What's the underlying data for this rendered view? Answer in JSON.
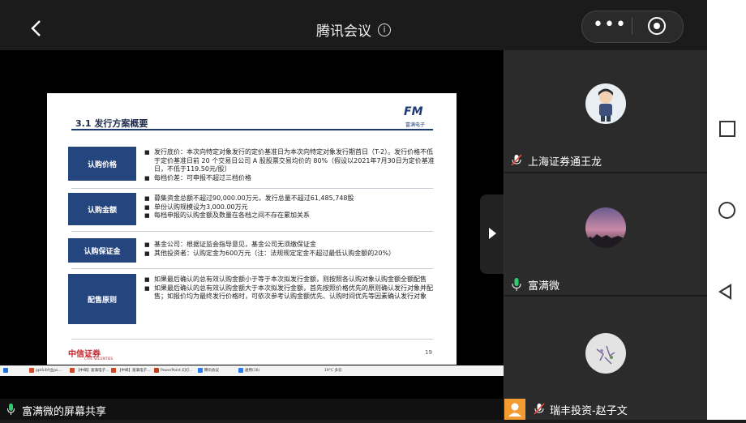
{
  "header": {
    "title": "腾讯会议",
    "more_icon": "more-horizontal-icon",
    "record_icon": "record-icon"
  },
  "slide": {
    "title": "3.1 发行方案概要",
    "logo": "FM",
    "logo_sub": "富满电子",
    "sections": [
      {
        "label": "认购价格",
        "bullets": [
          "发行底价：本次向特定对象发行的定价基准日为本次向特定对象发行期首日（T-2）。发行价格不低于定价基准日前 20 个交易日公司 A 股股票交易均价的 80%（假设以2021年7月30日为定价基准日，不低于119.50元/股）",
          "每档价差：可申报不超过三档价格"
        ]
      },
      {
        "label": "认购金额",
        "bullets": [
          "募集资金总额不超过90,000.00万元，发行总量不超过61,485,748股",
          "单份认购规模设为3,000.00万元",
          "每档申报的认购金额及数量在各档之间不存在累加关系"
        ]
      },
      {
        "label": "认购保证金",
        "bullets": [
          "基金公司：根据证监会指导意见，基金公司无须缴保证金",
          "其他投资者：认购定金为600万元（注：法规规定定金不超过最低认购金额的20%）"
        ]
      },
      {
        "label": "配售原则",
        "bullets": [
          "如果最后确认的总有效认购金额小于等于本次拟发行金额，则按照各认购对象认购金额全额配售",
          "如果最后确认的总有效认购金额大于本次拟发行金额，首先按照价格优先的原则确认发行对象并配售；如报价均为最终发行价格时，可依次参考认购金额优先、认购时间优先等因素确认发行对象"
        ]
      }
    ],
    "footer_logo": "中信证券",
    "footer_logo_sub": "CITIC SECURITIES",
    "page_number": "19"
  },
  "taskbar": {
    "items": [
      "ppt14兴业ps...",
      "【中邮】富满电子...",
      "【中邮】富满电子...",
      "PowerPoint 幻灯...",
      "腾讯会议",
      "通用(16)"
    ],
    "weather": "19°C 多云"
  },
  "share": {
    "label": "富满微的屏幕共享"
  },
  "participants": [
    {
      "name": "上海证券通王龙",
      "mic": "muted"
    },
    {
      "name": "富满微",
      "mic": "on"
    },
    {
      "name": "瑞丰投资-赵子文",
      "mic": "muted"
    }
  ],
  "colors": {
    "slide_accent": "#25457f",
    "mic_on": "#2ecc71",
    "mic_off": "#e74c3c"
  }
}
